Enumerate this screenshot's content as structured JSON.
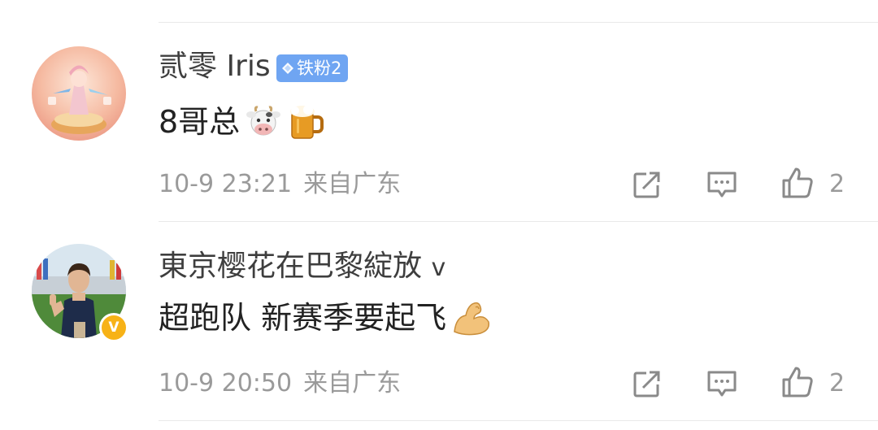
{
  "comments": [
    {
      "username": "贰零 Iris",
      "fan_badge": {
        "label": "铁粉2",
        "color": "#6fa5f2"
      },
      "content": "8哥总",
      "content_emojis": [
        "cow-face-emoji",
        "beer-mug-emoji"
      ],
      "date": "10-9 23:21",
      "location": "来自广东",
      "likes": "2",
      "avatar": "anime-figurine-avatar"
    },
    {
      "username": "東京樱花在巴黎綻放",
      "verified_suffix": "v",
      "content": "超跑队 新赛季要起飞",
      "content_emojis": [
        "flexed-biceps-emoji"
      ],
      "date": "10-9 20:50",
      "location": "来自广东",
      "likes": "2",
      "avatar": "man-thumbs-up-avatar",
      "verified_badge": "V"
    }
  ],
  "icons": {
    "share": "share-icon",
    "comment": "comment-icon",
    "like": "thumbs-up-icon"
  },
  "colors": {
    "fan_badge": "#6fa5f2",
    "verified": "#f7b217",
    "meta_text": "#9a9a9a"
  }
}
